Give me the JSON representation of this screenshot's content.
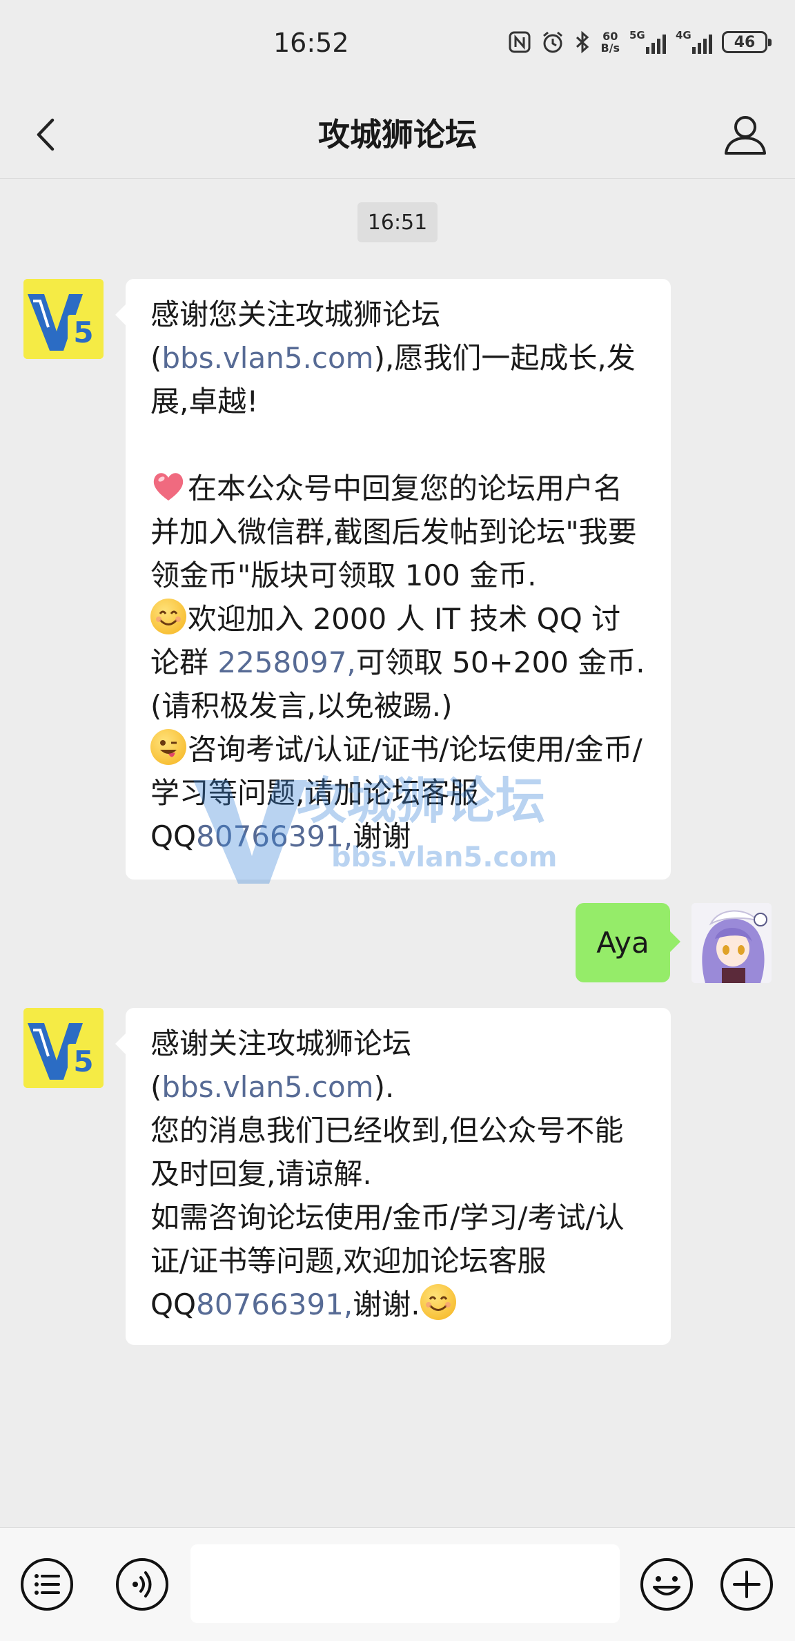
{
  "status_bar": {
    "time": "16:52",
    "net_speed_value": "60",
    "net_speed_unit": "B/s",
    "signal_1_label": "5G",
    "signal_2_label": "4G",
    "battery": "46",
    "icons": [
      "nfc-icon",
      "alarm-icon",
      "bluetooth-icon"
    ]
  },
  "header": {
    "title": "攻城狮论坛",
    "back_icon": "chevron-left-icon",
    "profile_icon": "person-icon"
  },
  "chat": {
    "timestamp": "16:51",
    "msg1": {
      "p1_a": "感谢您关注攻城狮论坛(",
      "p1_link": "bbs.vlan5.com",
      "p1_b": "),愿我们一起成长,发展,卓越!",
      "p2": "在本公众号中回复您的论坛用户名并加入微信群,截图后发帖到论坛\"我要领金币\"版块可领取 100 金币.",
      "p3_a": "欢迎加入 2000 人 IT 技术 QQ 讨论群 ",
      "p3_link": "2258097,",
      "p3_b": "可领取 50+200 金币.(请积极发言,以免被踢.)",
      "p4_a": "咨询考试/认证/证书/论坛使用/金币/学习等问题,请加论坛客服 QQ",
      "p4_link": "80766391,",
      "p4_b": "谢谢"
    },
    "user_msg": "Aya",
    "msg2": {
      "p1_a": "感谢关注攻城狮论坛(",
      "p1_link": "bbs.vlan5.com",
      "p1_b": ").",
      "p2": "您的消息我们已经收到,但公众号不能及时回复,请谅解.",
      "p3_a": "如需咨询论坛使用/金币/学习/考试/认证/证书等问题,欢迎加论坛客服 QQ",
      "p3_link": "80766391,",
      "p3_b": "谢谢."
    },
    "watermark_title": "攻城狮论坛",
    "watermark_url": "bbs.vlan5.com",
    "logo_text": "V5"
  },
  "bottom_bar": {
    "menu_icon": "menu-list-icon",
    "voice_icon": "voice-icon",
    "emoji_icon": "emoji-icon",
    "plus_icon": "plus-icon",
    "input_value": ""
  },
  "colors": {
    "background": "#ededed",
    "bubble_left": "#ffffff",
    "bubble_right": "#95ec69",
    "link": "#576b95",
    "logo_bg": "#f5eb45",
    "logo_blue": "#2b6cc4"
  }
}
